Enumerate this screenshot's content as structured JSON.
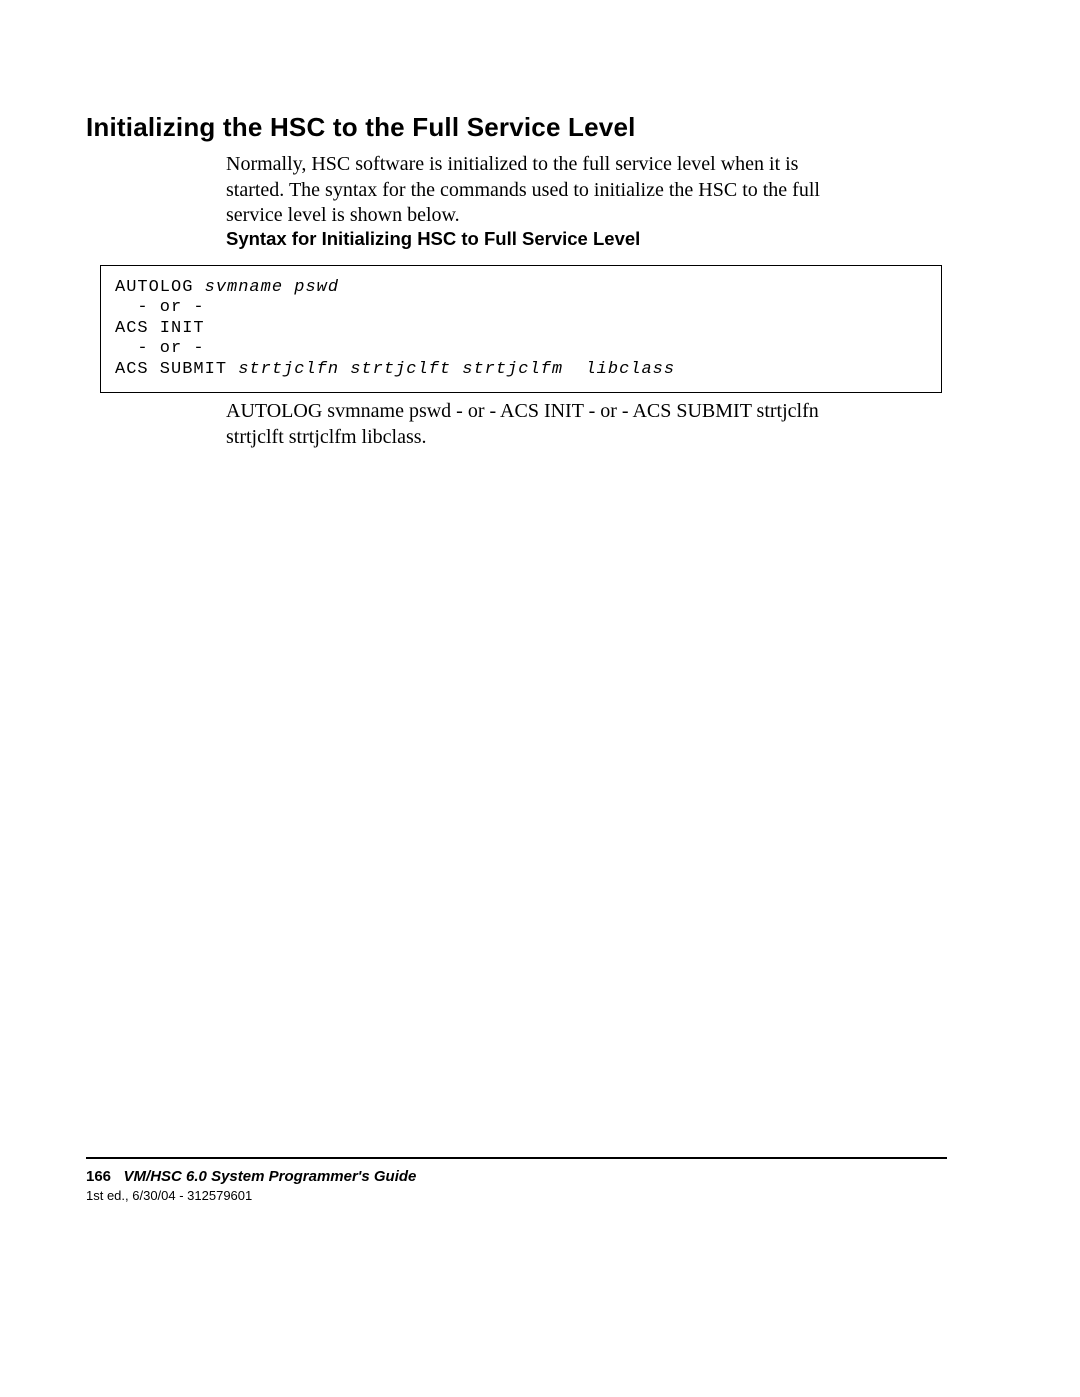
{
  "heading": "Initializing the HSC to the Full Service Level",
  "intro": "Normally, HSC software is initialized to the full service level when it is started. The syntax for the commands used to initialize the HSC to the full service level is shown below.",
  "subheading": "Syntax for Initializing HSC to Full Service Level",
  "code": {
    "l1a": "AUTOLOG ",
    "l1b": "svmname pswd",
    "l2": "  - or -",
    "l3": "ACS INIT",
    "l4": "  - or -",
    "l5a": "ACS SUBMIT ",
    "l5b": "strtjclfn strtjclft strtjclfm  libclass"
  },
  "body2": "AUTOLOG svmname pswd - or - ACS INIT - or - ACS SUBMIT strtjclfn strtjclft strtjclfm libclass.",
  "footer": {
    "page": "166",
    "title": "VM/HSC 6.0 System Programmer's Guide",
    "sub": "1st ed., 6/30/04 - 312579601"
  }
}
